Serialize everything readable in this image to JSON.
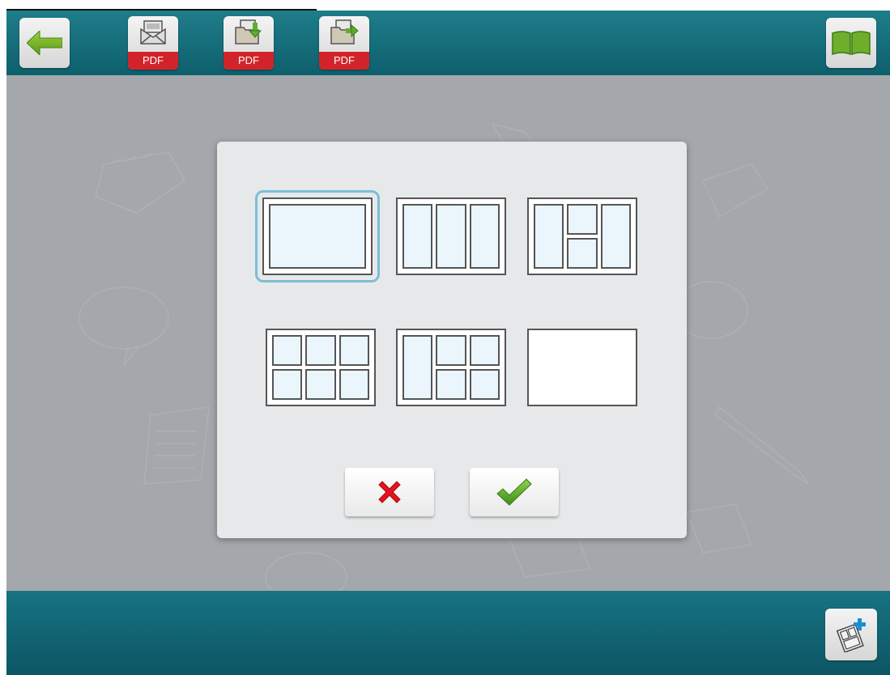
{
  "toolbar": {
    "back_icon": "back-arrow-icon",
    "pdf_email_label": "PDF",
    "pdf_save_label": "PDF",
    "pdf_export_label": "PDF",
    "book_icon": "open-book-icon"
  },
  "dialog": {
    "layouts": [
      {
        "name": "single-panel",
        "selected": true
      },
      {
        "name": "three-columns",
        "selected": false
      },
      {
        "name": "column-grid-column",
        "selected": false
      },
      {
        "name": "six-panel-grid",
        "selected": false
      },
      {
        "name": "column-plus-four-grid",
        "selected": false
      },
      {
        "name": "blank",
        "selected": false
      }
    ],
    "cancel_icon": "red-x-icon",
    "confirm_icon": "green-check-icon"
  },
  "bottombar": {
    "add_page_icon": "add-page-icon"
  },
  "colors": {
    "bar_teal": "#127080",
    "selection_blue": "#7bbfd6",
    "pdf_red": "#d2232a",
    "cancel_red": "#e0141e",
    "confirm_green": "#4ea82a"
  }
}
